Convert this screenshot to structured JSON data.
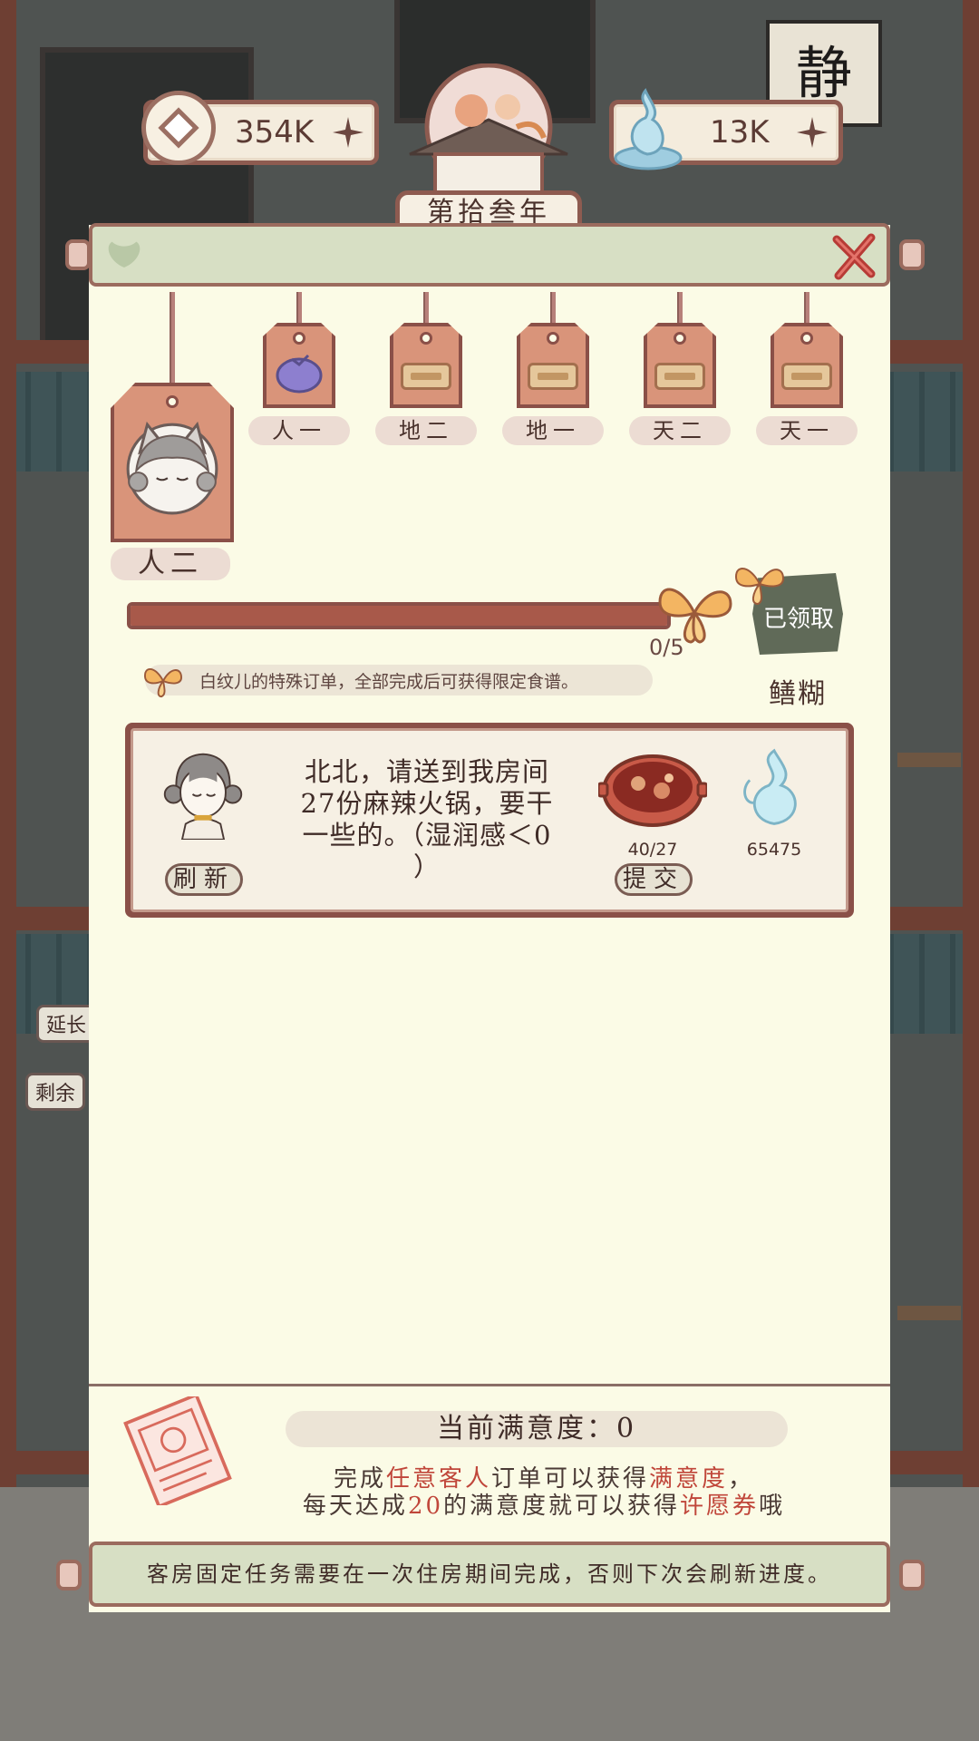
{
  "resources": {
    "coins": "354K",
    "spirit": "13K"
  },
  "year": "第拾叁年",
  "tags": [
    {
      "label": "人一",
      "icon": "purple-pouch-icon"
    },
    {
      "label": "地二",
      "icon": "chest-icon"
    },
    {
      "label": "地一",
      "icon": "chest-icon"
    },
    {
      "label": "天二",
      "icon": "chest-icon"
    },
    {
      "label": "天一",
      "icon": "chest-icon"
    }
  ],
  "current_tag": {
    "label": "人二",
    "icon": "fox-girl-portrait"
  },
  "progress": {
    "current": 0,
    "total": 5,
    "text": "0/5"
  },
  "reward": {
    "status": "已领取",
    "name": "鳝糊"
  },
  "hint": "白纹儿的特殊订单，全部完成后可获得限定食谱。",
  "order": {
    "lines": [
      "北北，请送到我房间",
      "27份麻辣火锅，要干",
      "一些的。（湿润感＜0",
      "）"
    ],
    "refresh_label": "刷新",
    "submit_label": "提交",
    "dish_count": "40/27",
    "reward_amount": "65475"
  },
  "satisfaction": {
    "title": "当前满意度：0",
    "line1": {
      "a": "完成",
      "b": "任意客人",
      "c": "订单可以获得",
      "d": "满意度",
      "e": "，"
    },
    "line2": {
      "a": "每天达成",
      "b": "20",
      "c": "的满意度就可以获得",
      "d": "许愿券",
      "e": "哦"
    }
  },
  "footer": "客房固定任务需要在一次住房期间完成，否则下次会刷新进度。",
  "side_labels": [
    "延长",
    "剩余"
  ],
  "wall_art": "静",
  "colors": {
    "panel": "#fbfbe6",
    "frame": "#8a5048",
    "highlight": "#c0463a",
    "rod": "#d7dfc4"
  }
}
